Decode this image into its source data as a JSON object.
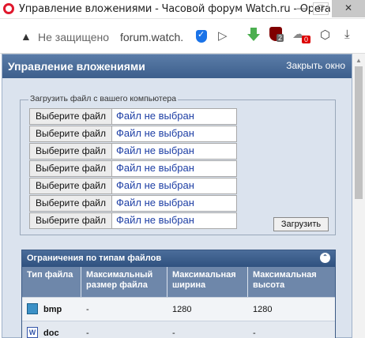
{
  "window": {
    "title": "Управление вложениями - Часовой форум Watch.ru - Opera",
    "controls": {
      "minimize": "—",
      "maximize": "☐",
      "close": "✕"
    }
  },
  "address_bar": {
    "security_text": "Не защищено",
    "url": "forum.watch.",
    "extensions": [
      {
        "name": "shield-icon"
      },
      {
        "name": "send-icon"
      },
      {
        "name": "download-manager-icon"
      },
      {
        "name": "ublock-icon",
        "badge": "2"
      },
      {
        "name": "cloud-icon",
        "badge": "0"
      },
      {
        "name": "cube-icon"
      },
      {
        "name": "downloads-icon"
      }
    ]
  },
  "panel": {
    "title": "Управление вложениями",
    "close_label": "Закрыть окно"
  },
  "upload": {
    "legend": "Загрузить файл с вашего компьютера",
    "rows": [
      {
        "button": "Выберите файл",
        "status": "Файл не выбран"
      },
      {
        "button": "Выберите файл",
        "status": "Файл не выбран"
      },
      {
        "button": "Выберите файл",
        "status": "Файл не выбран"
      },
      {
        "button": "Выберите файл",
        "status": "Файл не выбран"
      },
      {
        "button": "Выберите файл",
        "status": "Файл не выбран"
      },
      {
        "button": "Выберите файл",
        "status": "Файл не выбран"
      },
      {
        "button": "Выберите файл",
        "status": "Файл не выбран"
      }
    ],
    "submit_label": "Загрузить"
  },
  "limits": {
    "title": "Ограничения по типам файлов",
    "columns": [
      "Тип файла",
      "Максимальный размер файла",
      "Максимальная ширина",
      "Максимальная высота"
    ],
    "rows": [
      {
        "icon": "bmp-file-icon",
        "type": "bmp",
        "max_size": "-",
        "max_width": "1280",
        "max_height": "1280"
      },
      {
        "icon": "doc-file-icon",
        "type": "doc",
        "max_size": "-",
        "max_width": "-",
        "max_height": "-"
      }
    ]
  },
  "colors": {
    "panel_header": "#4a6c98",
    "panel_bg": "#dbe3ee",
    "file_status_text": "#1e3fa5",
    "close_button": "#c8c8c8"
  }
}
